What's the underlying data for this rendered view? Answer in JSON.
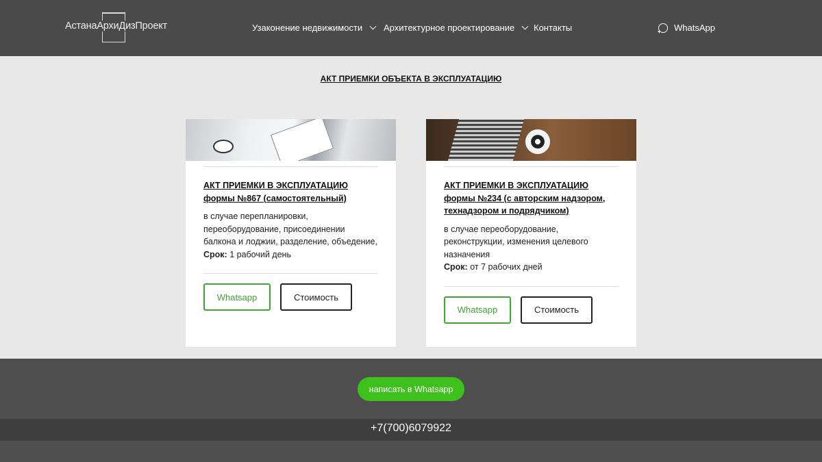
{
  "header": {
    "logo_text": "АстанаАрхиДизПроект",
    "nav": [
      {
        "label": "Узаконение недвижимости",
        "has_dropdown": true
      },
      {
        "label": "Архитектурное проектирование",
        "has_dropdown": true
      },
      {
        "label": "Контакты",
        "has_dropdown": false
      }
    ],
    "whatsapp": "WhatsApp"
  },
  "page_title": "АКТ ПРИЕМКИ ОБЪЕКТА В ЭКСПЛУАТАЦИЮ",
  "cards": [
    {
      "title": "АКТ ПРИЕМКИ В ЭКСПЛУАТАЦИЮ формы №867 (самостоятельный)",
      "description": "в случае перепланировки, переоборудование, присоединении балкона и лоджии, разделение, объедение,",
      "term_label": "Срок:",
      "term": " 1 рабочий день",
      "btn_whatsapp": "Whatsapp",
      "btn_price": "Стоимость"
    },
    {
      "title": "АКТ ПРИЕМКИ В ЭКСПЛУАТАЦИЮ формы №234 (с авторским надзором, технадзором и подрядчиком)",
      "description": "в случае переоборудование, реконструкции, изменения целевого назначения",
      "term_label": "Срок:",
      "term": " от 7 рабочих дней",
      "btn_whatsapp": "Whatsapp",
      "btn_price": "Стоимость"
    }
  ],
  "footer": {
    "cta": "написать в Whatsapp",
    "phone": "+7(700)6079922"
  },
  "colors": {
    "header": "#4a4a4a",
    "accent_green": "#3ec11c",
    "button_green": "#3fa535"
  }
}
